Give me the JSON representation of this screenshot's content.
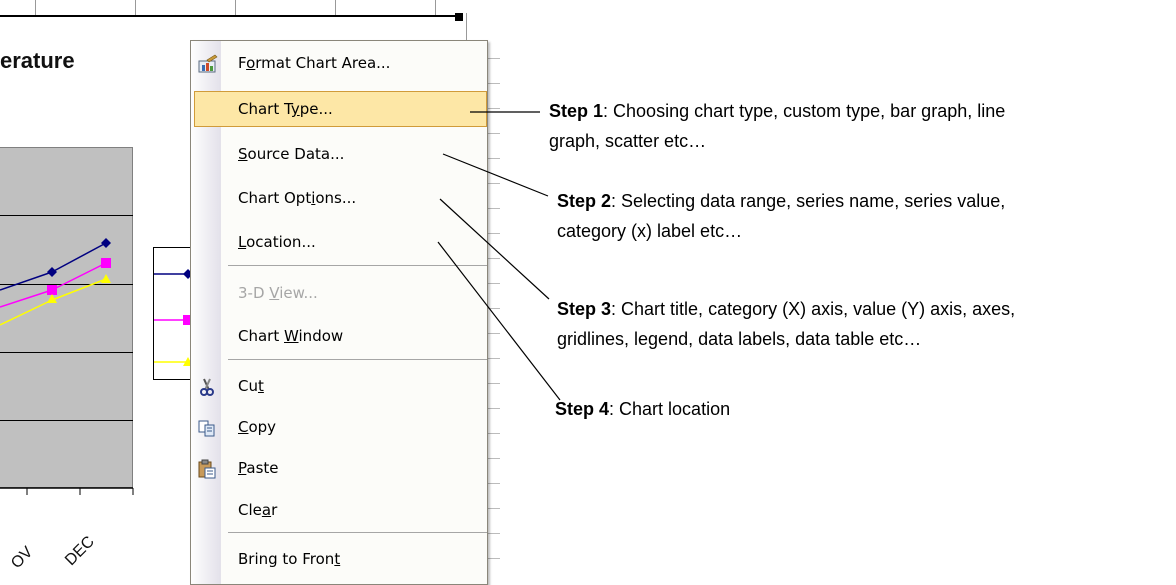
{
  "chart": {
    "title_fragment": "erature",
    "x_labels": [
      "OV",
      "DEC"
    ]
  },
  "menu": {
    "items": [
      {
        "pre": "F",
        "u": "o",
        "post": "rmat Chart Area...",
        "icon": "format-chart-area-icon",
        "disabled": false,
        "highlight": false
      },
      {
        "pre": "Chart T",
        "u": "y",
        "post": "pe...",
        "icon": "",
        "disabled": false,
        "highlight": true
      },
      {
        "pre": "",
        "u": "S",
        "post": "ource Data...",
        "icon": "",
        "disabled": false,
        "highlight": false
      },
      {
        "pre": "Chart Opt",
        "u": "i",
        "post": "ons...",
        "icon": "",
        "disabled": false,
        "highlight": false
      },
      {
        "pre": "",
        "u": "L",
        "post": "ocation...",
        "icon": "",
        "disabled": false,
        "highlight": false
      },
      {
        "pre": "3-D ",
        "u": "V",
        "post": "iew...",
        "icon": "",
        "disabled": true,
        "highlight": false
      },
      {
        "pre": "Chart ",
        "u": "W",
        "post": "indow",
        "icon": "",
        "disabled": false,
        "highlight": false
      },
      {
        "pre": "Cu",
        "u": "t",
        "post": "",
        "icon": "scissors-icon",
        "disabled": false,
        "highlight": false
      },
      {
        "pre": "",
        "u": "C",
        "post": "opy",
        "icon": "copy-icon",
        "disabled": false,
        "highlight": false
      },
      {
        "pre": "",
        "u": "P",
        "post": "aste",
        "icon": "paste-icon",
        "disabled": false,
        "highlight": false
      },
      {
        "pre": "Cle",
        "u": "a",
        "post": "r",
        "icon": "",
        "disabled": false,
        "highlight": false
      },
      {
        "pre": "Bring to Fron",
        "u": "t",
        "post": "",
        "icon": "",
        "disabled": false,
        "highlight": false
      }
    ]
  },
  "annotations": {
    "step1": {
      "label": "Step 1",
      "text": ": Choosing chart type, custom type, bar graph, line",
      "text2": "graph, scatter etc…"
    },
    "step2": {
      "label": "Step 2",
      "text": ": Selecting data range, series name, series value,",
      "text2": "category (x) label etc…"
    },
    "step3": {
      "label": "Step 3",
      "text": ": Chart title, category (X) axis, value (Y) axis, axes,",
      "text2": "gridlines, legend, data labels, data table etc…"
    },
    "step4": {
      "label": "Step 4",
      "text": ": Chart location"
    }
  },
  "colors": {
    "highlight_bg": "#fde7a6",
    "highlight_border": "#d09b3a",
    "plot_bg": "#c0c0c0",
    "series1": "#000080",
    "series2": "#ff00ff",
    "series3": "#ffff00"
  }
}
